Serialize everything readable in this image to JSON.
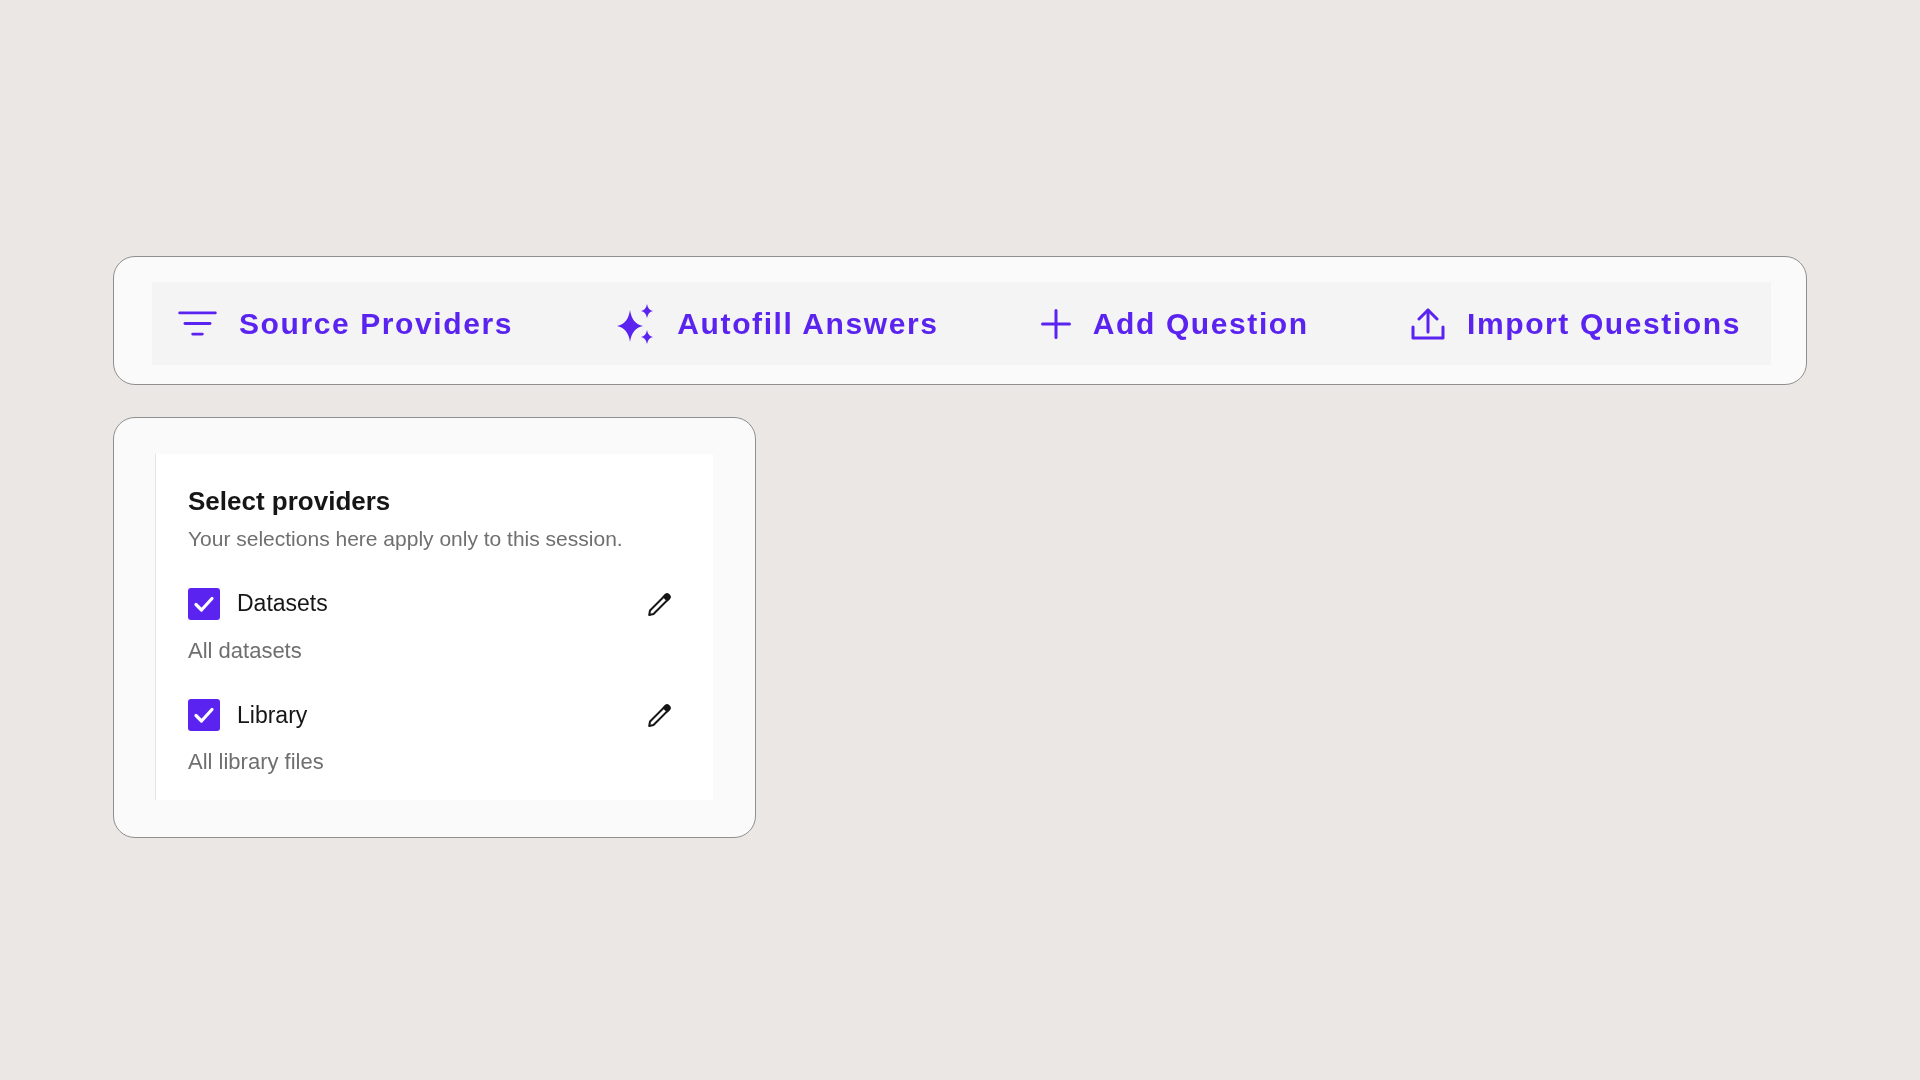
{
  "toolbar": {
    "actions": [
      {
        "kind": "filter",
        "label": "Source Providers"
      },
      {
        "kind": "sparkle",
        "label": "Autofill Answers"
      },
      {
        "kind": "add",
        "label": "Add Question"
      },
      {
        "kind": "upload",
        "label": "Import Questions"
      }
    ]
  },
  "provider_panel": {
    "title": "Select providers",
    "subtitle": "Your selections here apply only to this session.",
    "providers": [
      {
        "label": "Datasets",
        "checked": true,
        "detail": "All datasets"
      },
      {
        "label": "Library",
        "checked": true,
        "detail": "All library files"
      }
    ]
  }
}
